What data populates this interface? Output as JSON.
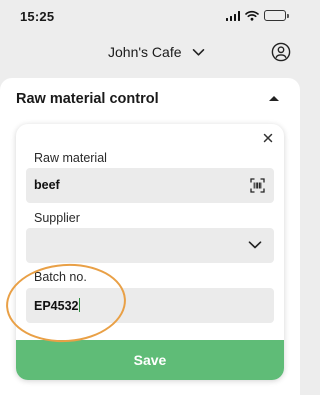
{
  "status_bar": {
    "time": "15:25"
  },
  "header": {
    "cafe_name": "John's Cafe"
  },
  "section": {
    "title": "Raw material control"
  },
  "form": {
    "raw_material": {
      "label": "Raw material",
      "value": "beef"
    },
    "supplier": {
      "label": "Supplier",
      "value": ""
    },
    "batch": {
      "label": "Batch no.",
      "value": "EP4532"
    },
    "save_label": "Save"
  },
  "icons": {
    "signal": "signal-icon",
    "wifi": "wifi-icon",
    "battery": "battery-icon",
    "cafe_dropdown": "chevron-down-icon",
    "profile": "profile-icon",
    "collapse": "chevron-up-icon",
    "close": "close-icon",
    "scan": "barcode-scan-icon",
    "supplier_dropdown": "chevron-down-icon"
  },
  "colors": {
    "accent": "#5fbc77",
    "annotation": "#e9a046",
    "background": "#ededed",
    "field": "#ebebeb"
  }
}
